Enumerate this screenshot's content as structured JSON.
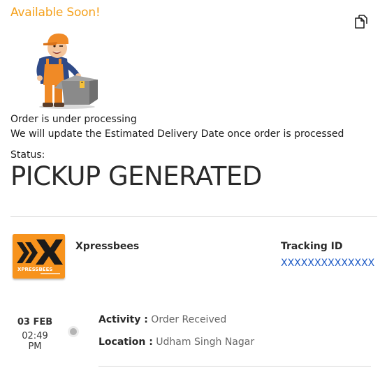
{
  "header": {
    "availability": "Available Soon!",
    "copy_icon": "copy-icon"
  },
  "illustration": {
    "name": "delivery-worker-with-box"
  },
  "message": {
    "title": "Order is under processing",
    "subtitle": "We will update the Estimated Delivery Date once order is processed"
  },
  "status": {
    "label": "Status:",
    "value": "PICKUP GENERATED"
  },
  "courier": {
    "name": "Xpressbees",
    "logo_text": "XPRESSBEES",
    "tracking_label": "Tracking ID",
    "tracking_id": "XXXXXXXXXXXXXX"
  },
  "timeline": [
    {
      "date": "03 FEB",
      "time": "02:49 PM",
      "activity_label": "Activity :",
      "activity_value": "Order Received",
      "location_label": "Location :",
      "location_value": "Udham Singh Nagar"
    }
  ],
  "colors": {
    "accent": "#f5a11c",
    "link": "#1e5bc6",
    "logo_bg": "#f7931d",
    "divider": "#d8d8d8"
  }
}
